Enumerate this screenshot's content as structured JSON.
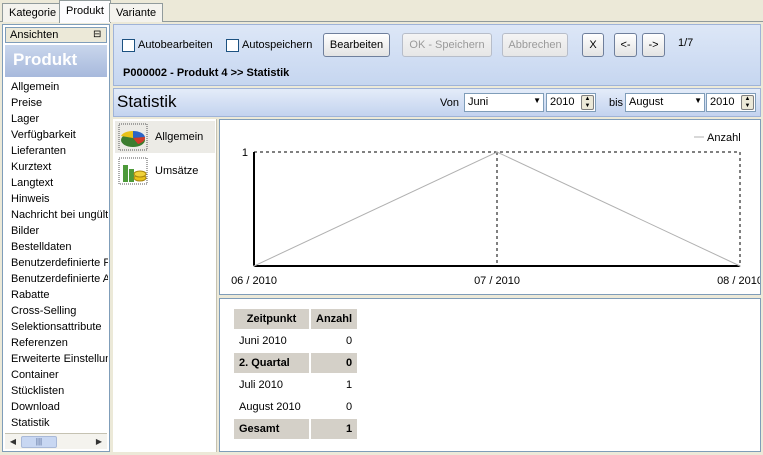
{
  "top_tabs": [
    "Kategorie",
    "Produkt",
    "Variante"
  ],
  "left": {
    "ansichten": "Ansichten",
    "header": "Produkt",
    "nav_items": [
      "Allgemein",
      "Preise",
      "Lager",
      "Verfügbarkeit",
      "Lieferanten",
      "Kurztext",
      "Langtext",
      "Hinweis",
      "Nachricht bei ungült",
      "Bilder",
      "Bestelldaten",
      "Benutzerdefinierte P",
      "Benutzerdefinierte A",
      "Rabatte",
      "Cross-Selling",
      "Selektionsattribute",
      "Referenzen",
      "Erweiterte Einstellun",
      "Container",
      "Stücklisten",
      "Download",
      "Statistik"
    ]
  },
  "toolbar": {
    "autobearbeiten": "Autobearbeiten",
    "autospeichern": "Autospeichern",
    "bearbeiten": "Bearbeiten",
    "ok_speichern": "OK - Speichern",
    "abbrechen": "Abbrechen",
    "close": "X",
    "prev": "<-",
    "next": "->",
    "counter": "1/7",
    "breadcrumb": "P000002 - Produkt 4 >> Statistik"
  },
  "stat_bar": {
    "title": "Statistik",
    "von_label": "Von",
    "von_month": "Juni",
    "von_year": "2010",
    "bis_label": "bis",
    "bis_month": "August",
    "bis_year": "2010"
  },
  "subnav": [
    {
      "label": "Allgemein",
      "icon": "pie-chart-icon"
    },
    {
      "label": "Umsätze",
      "icon": "bar-chart-coins-icon"
    }
  ],
  "chart_data": {
    "type": "line",
    "categories": [
      "06 / 2010",
      "07 / 2010",
      "08 / 2010"
    ],
    "series": [
      {
        "name": "Anzahl",
        "values": [
          0,
          1,
          0
        ]
      }
    ],
    "ylim": [
      0,
      1
    ],
    "y_ticks": [
      "1"
    ],
    "legend": "top-right",
    "grid": true
  },
  "table": {
    "headers": [
      "Zeitpunkt",
      "Anzahl"
    ],
    "rows": [
      {
        "label": "Juni 2010",
        "value": "0",
        "highlight": false
      },
      {
        "label": "2. Quartal",
        "value": "0",
        "highlight": true
      },
      {
        "label": "Juli 2010",
        "value": "1",
        "highlight": false
      },
      {
        "label": "August 2010",
        "value": "0",
        "highlight": false
      },
      {
        "label": "Gesamt",
        "value": "1",
        "highlight": true
      }
    ]
  }
}
